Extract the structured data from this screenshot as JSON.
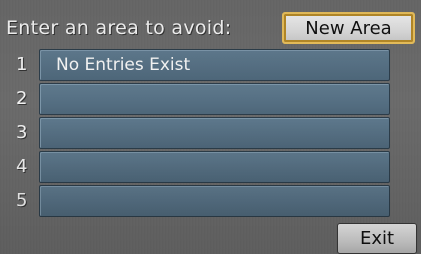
{
  "header": {
    "prompt": "Enter an area to avoid:"
  },
  "buttons": {
    "new_area": "New Area",
    "exit": "Exit"
  },
  "entries": [
    {
      "number": "1",
      "text": "No Entries Exist"
    },
    {
      "number": "2",
      "text": ""
    },
    {
      "number": "3",
      "text": ""
    },
    {
      "number": "4",
      "text": ""
    },
    {
      "number": "5",
      "text": ""
    }
  ],
  "colors": {
    "entry_fill": "#5a7489",
    "selection_border": "#e9c05c",
    "background": "#6a6a6a"
  }
}
